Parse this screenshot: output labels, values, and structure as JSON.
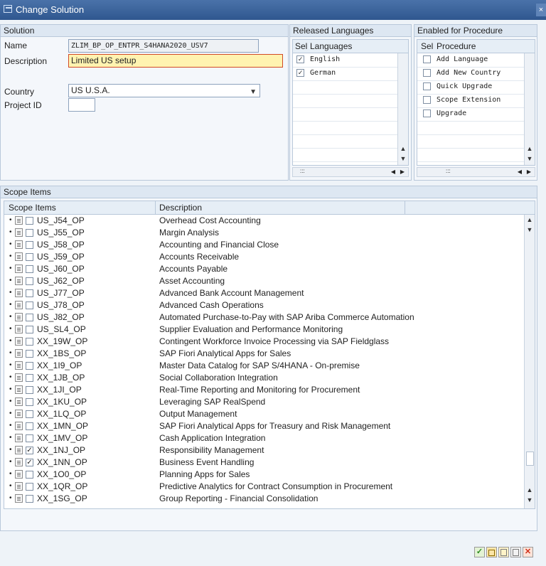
{
  "window": {
    "title": "Change Solution",
    "close": "×"
  },
  "solution": {
    "header": "Solution",
    "name_label": "Name",
    "name_value": "ZLIM_BP_OP_ENTPR_S4HANA2020_USV7",
    "description_label": "Description",
    "description_value": "Limited US setup",
    "country_label": "Country",
    "country_value": "US U.S.A.",
    "project_label": "Project ID",
    "project_value": ""
  },
  "released_languages": {
    "header": "Released Languages",
    "col_sel": "Sel",
    "col_lang": "Languages",
    "rows": [
      {
        "checked": true,
        "label": "English"
      },
      {
        "checked": true,
        "label": "German"
      }
    ],
    "hscroll_grip": ":::"
  },
  "enabled_procedure": {
    "header": "Enabled for Procedure",
    "col_sel": "Sel",
    "col_proc": "Procedure",
    "rows": [
      {
        "checked": false,
        "label": "Add Language"
      },
      {
        "checked": false,
        "label": "Add New Country"
      },
      {
        "checked": false,
        "label": "Quick Upgrade"
      },
      {
        "checked": false,
        "label": "Scope Extension"
      },
      {
        "checked": false,
        "label": "Upgrade"
      }
    ],
    "hscroll_grip": ":::"
  },
  "scope_items": {
    "header": "Scope Items",
    "col_items": "Scope Items",
    "col_desc": "Description",
    "rows": [
      {
        "code": "US_J54_OP",
        "desc": "Overhead Cost Accounting",
        "checked": false
      },
      {
        "code": "US_J55_OP",
        "desc": "Margin Analysis",
        "checked": false
      },
      {
        "code": "US_J58_OP",
        "desc": "Accounting and Financial Close",
        "checked": false
      },
      {
        "code": "US_J59_OP",
        "desc": "Accounts Receivable",
        "checked": false
      },
      {
        "code": "US_J60_OP",
        "desc": "Accounts Payable",
        "checked": false
      },
      {
        "code": "US_J62_OP",
        "desc": "Asset Accounting",
        "checked": false
      },
      {
        "code": "US_J77_OP",
        "desc": "Advanced Bank Account Management",
        "checked": false
      },
      {
        "code": "US_J78_OP",
        "desc": "Advanced Cash Operations",
        "checked": false
      },
      {
        "code": "US_J82_OP",
        "desc": "Automated Purchase-to-Pay with SAP Ariba Commerce Automation",
        "checked": false
      },
      {
        "code": "US_SL4_OP",
        "desc": "Supplier Evaluation and Performance Monitoring",
        "checked": false
      },
      {
        "code": "XX_19W_OP",
        "desc": "Contingent Workforce Invoice Processing via SAP Fieldglass",
        "checked": false
      },
      {
        "code": "XX_1BS_OP",
        "desc": "SAP Fiori Analytical Apps for Sales",
        "checked": false
      },
      {
        "code": "XX_1I9_OP",
        "desc": "Master Data Catalog for SAP S/4HANA - On-premise",
        "checked": false
      },
      {
        "code": "XX_1JB_OP",
        "desc": "Social Collaboration Integration",
        "checked": false
      },
      {
        "code": "XX_1JI_OP",
        "desc": "Real-Time Reporting and Monitoring for Procurement",
        "checked": false
      },
      {
        "code": "XX_1KU_OP",
        "desc": "Leveraging SAP RealSpend",
        "checked": false
      },
      {
        "code": "XX_1LQ_OP",
        "desc": "Output Management",
        "checked": false
      },
      {
        "code": "XX_1MN_OP",
        "desc": "SAP Fiori Analytical Apps for Treasury and Risk Management",
        "checked": false
      },
      {
        "code": "XX_1MV_OP",
        "desc": "Cash Application Integration",
        "checked": false
      },
      {
        "code": "XX_1NJ_OP",
        "desc": "Responsibility Management",
        "checked": true
      },
      {
        "code": "XX_1NN_OP",
        "desc": "Business Event Handling",
        "checked": true
      },
      {
        "code": "XX_1O0_OP",
        "desc": "Planning Apps for Sales",
        "checked": false
      },
      {
        "code": "XX_1QR_OP",
        "desc": "Predictive Analytics for Contract Consumption in Procurement",
        "checked": false
      },
      {
        "code": "XX_1SG_OP",
        "desc": "Group Reporting - Financial Consolidation",
        "checked": false
      }
    ]
  },
  "toolbar": {
    "icons": [
      "check-icon",
      "save-icon",
      "copy-icon",
      "new-icon",
      "cancel-icon"
    ]
  },
  "symbols": {
    "check": "✓",
    "arrow_up": "▲",
    "arrow_down": "▼",
    "arrow_left": "◀",
    "arrow_right": "▶",
    "bullet": "•",
    "dropdown": "▼",
    "cancel": "✕"
  }
}
